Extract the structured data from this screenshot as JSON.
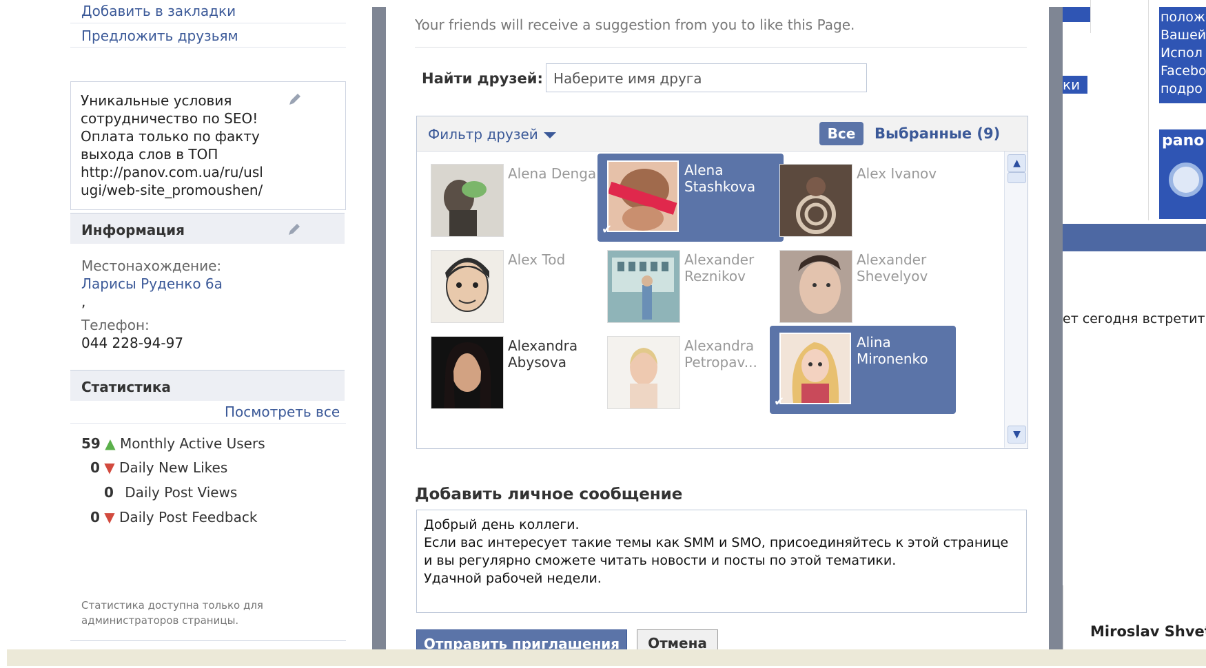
{
  "left": {
    "links": [
      "Добавить в закладки",
      "Предложить друзьям"
    ],
    "promo_text": "Уникальные условия\nсотрудничество по SEO!\nОплата только по факту\nвыхода слов в ТОП\nhttp://panov.com.ua/ru/usl\nugi/web-site_promoushen/",
    "info": {
      "title": "Информация",
      "location_label": "Местонахождение:",
      "location_value": "Ларисы Руденко 6а",
      "location_extra": ",",
      "phone_label": "Телефон:",
      "phone_value": "044 228-94-97"
    },
    "stats": {
      "title": "Статистика",
      "view_all": "Посмотреть все",
      "rows": [
        {
          "value": "59",
          "trend": "up",
          "label": "Monthly Active Users"
        },
        {
          "value": "0",
          "trend": "down",
          "label": "Daily New Likes"
        },
        {
          "value": "0",
          "trend": "none",
          "label": "Daily Post Views"
        },
        {
          "value": "0",
          "trend": "down",
          "label": "Daily Post Feedback"
        }
      ],
      "note": "Статистика доступна только для администраторов страницы."
    }
  },
  "modal": {
    "intro": "Your friends will receive a suggestion from you to like this Page.",
    "find_label": "Найти друзей:",
    "find_placeholder": "Наберите имя друга",
    "filter_label": "Фильтр друзей",
    "all_label": "Все",
    "selected_label": "Выбранные (9)",
    "friends": [
      {
        "name": "Alena Denga",
        "selected": false,
        "dark": false
      },
      {
        "name": "Alena Stashkova",
        "selected": true,
        "dark": false
      },
      {
        "name": "Alex Ivanov",
        "selected": false,
        "dark": false
      },
      {
        "name": "Alex Tod",
        "selected": false,
        "dark": false
      },
      {
        "name": "Alexander Reznikov",
        "selected": false,
        "dark": false
      },
      {
        "name": "Alexander Shevelyov",
        "selected": false,
        "dark": false
      },
      {
        "name": "Alexandra Abysova",
        "selected": false,
        "dark": true
      },
      {
        "name": "Alexandra Petropav...",
        "selected": false,
        "dark": false
      },
      {
        "name": "Alina Mironenko",
        "selected": true,
        "dark": false
      }
    ],
    "message_heading": "Добавить личное сообщение",
    "message_text": "Добрый день коллеги.\nЕсли вас интересует такие темы как SMM и SMO, присоединяйтесь к этой странице\nи вы регулярно сможете читать новости и посты по этой тематики.\nУдачной рабочей недели.",
    "send_label": "Отправить приглашения",
    "cancel_label": "Отмена"
  },
  "right": {
    "box_text": "положе\nВашей\nИспол\nFacebo\nподро",
    "ki_text": "ки",
    "box2_title": "pano",
    "partial_text": "ет сегодня встретит",
    "partial_name": "Miroslav Shvet"
  },
  "colors": {
    "fb_blue": "#3b5998",
    "selected_tile": "#5b74a8",
    "stat_up": "#5bb04b",
    "stat_down": "#d24a3e"
  }
}
